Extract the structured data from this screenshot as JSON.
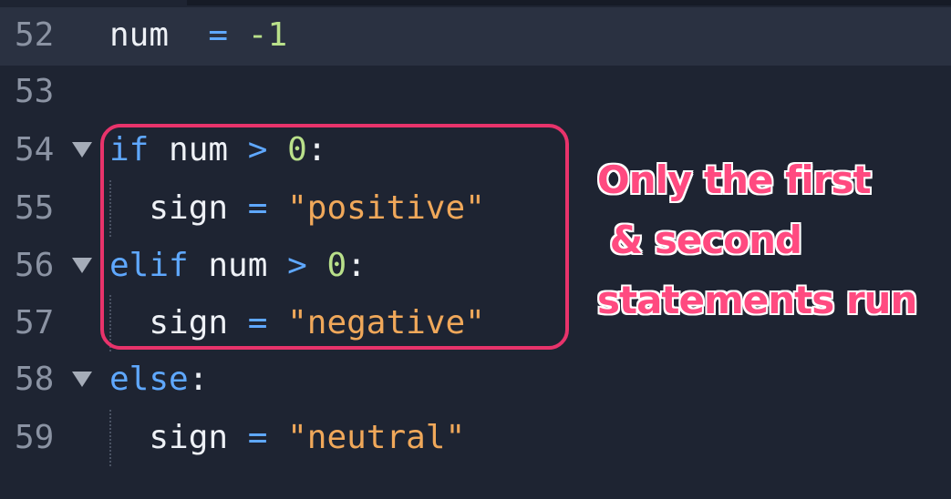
{
  "lines": [
    {
      "number": "52",
      "tokens": [
        {
          "t": "num",
          "c": "id"
        },
        {
          "t": "  ",
          "c": "id"
        },
        {
          "t": "=",
          "c": "op"
        },
        {
          "t": " ",
          "c": "id"
        },
        {
          "t": "-1",
          "c": "num"
        }
      ]
    },
    {
      "number": "53",
      "tokens": []
    },
    {
      "number": "54",
      "tokens": [
        {
          "t": "if",
          "c": "kw"
        },
        {
          "t": " num ",
          "c": "id"
        },
        {
          "t": ">",
          "c": "op"
        },
        {
          "t": " ",
          "c": "id"
        },
        {
          "t": "0",
          "c": "num"
        },
        {
          "t": ":",
          "c": "id"
        }
      ]
    },
    {
      "number": "55",
      "tokens": [
        {
          "t": "  sign ",
          "c": "id"
        },
        {
          "t": "=",
          "c": "op"
        },
        {
          "t": " ",
          "c": "id"
        },
        {
          "t": "\"positive\"",
          "c": "str"
        }
      ]
    },
    {
      "number": "56",
      "tokens": [
        {
          "t": "elif",
          "c": "kw"
        },
        {
          "t": " num ",
          "c": "id"
        },
        {
          "t": ">",
          "c": "op"
        },
        {
          "t": " ",
          "c": "id"
        },
        {
          "t": "0",
          "c": "num"
        },
        {
          "t": ":",
          "c": "id"
        }
      ]
    },
    {
      "number": "57",
      "tokens": [
        {
          "t": "  sign ",
          "c": "id"
        },
        {
          "t": "=",
          "c": "op"
        },
        {
          "t": " ",
          "c": "id"
        },
        {
          "t": "\"negative\"",
          "c": "str"
        }
      ]
    },
    {
      "number": "58",
      "tokens": [
        {
          "t": "else",
          "c": "kw"
        },
        {
          "t": ":",
          "c": "id"
        }
      ]
    },
    {
      "number": "59",
      "tokens": [
        {
          "t": "  sign ",
          "c": "id"
        },
        {
          "t": "=",
          "c": "op"
        },
        {
          "t": " ",
          "c": "id"
        },
        {
          "t": "\"neutral\"",
          "c": "str"
        }
      ]
    }
  ],
  "current_line": "52",
  "folded_lines": [
    "54",
    "56",
    "58"
  ],
  "indented_lines": [
    "55",
    "57",
    "59"
  ],
  "fold_icon": "triangle-down-icon",
  "annotation": {
    "text": "Only the first\n & second\nstatements run",
    "color": "#ff4a80"
  },
  "colors": {
    "background": "#1e2432",
    "current_line": "#2a3141",
    "keyword": "#5fa8ff",
    "number": "#b9e08a",
    "string": "#f0a85a",
    "callout_border": "#e8336b"
  }
}
